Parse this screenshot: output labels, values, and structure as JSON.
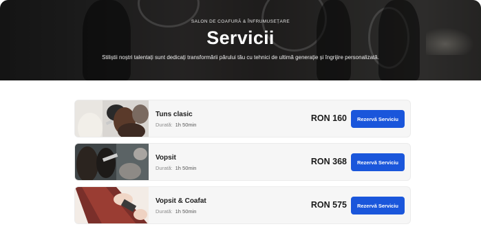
{
  "hero": {
    "eyebrow": "SALON DE COAFURĂ & ÎNFRUMUSEȚARE",
    "title": "Servicii",
    "subtitle": "Stiliștii noștri talentați sunt dedicați transformării părului tău cu tehnici de ultimă generație și îngrijire personalizată."
  },
  "services": [
    {
      "name": "Tuns clasic",
      "duration_label": "Durată:",
      "duration": "1h 50min",
      "price": "RON 160",
      "button": "Rezervă Serviciu",
      "image": "haircut-photo"
    },
    {
      "name": "Vopsit",
      "duration_label": "Durată:",
      "duration": "1h 50min",
      "price": "RON 368",
      "button": "Rezervă Serviciu",
      "image": "hair-coloring-photo"
    },
    {
      "name": "Vopsit & Coafat",
      "duration_label": "Durată:",
      "duration": "1h 50min",
      "price": "RON 575",
      "button": "Rezervă Serviciu",
      "image": "hair-styling-photo"
    }
  ],
  "colors": {
    "accent": "#1a56db",
    "card_bg": "#f6f6f6"
  }
}
